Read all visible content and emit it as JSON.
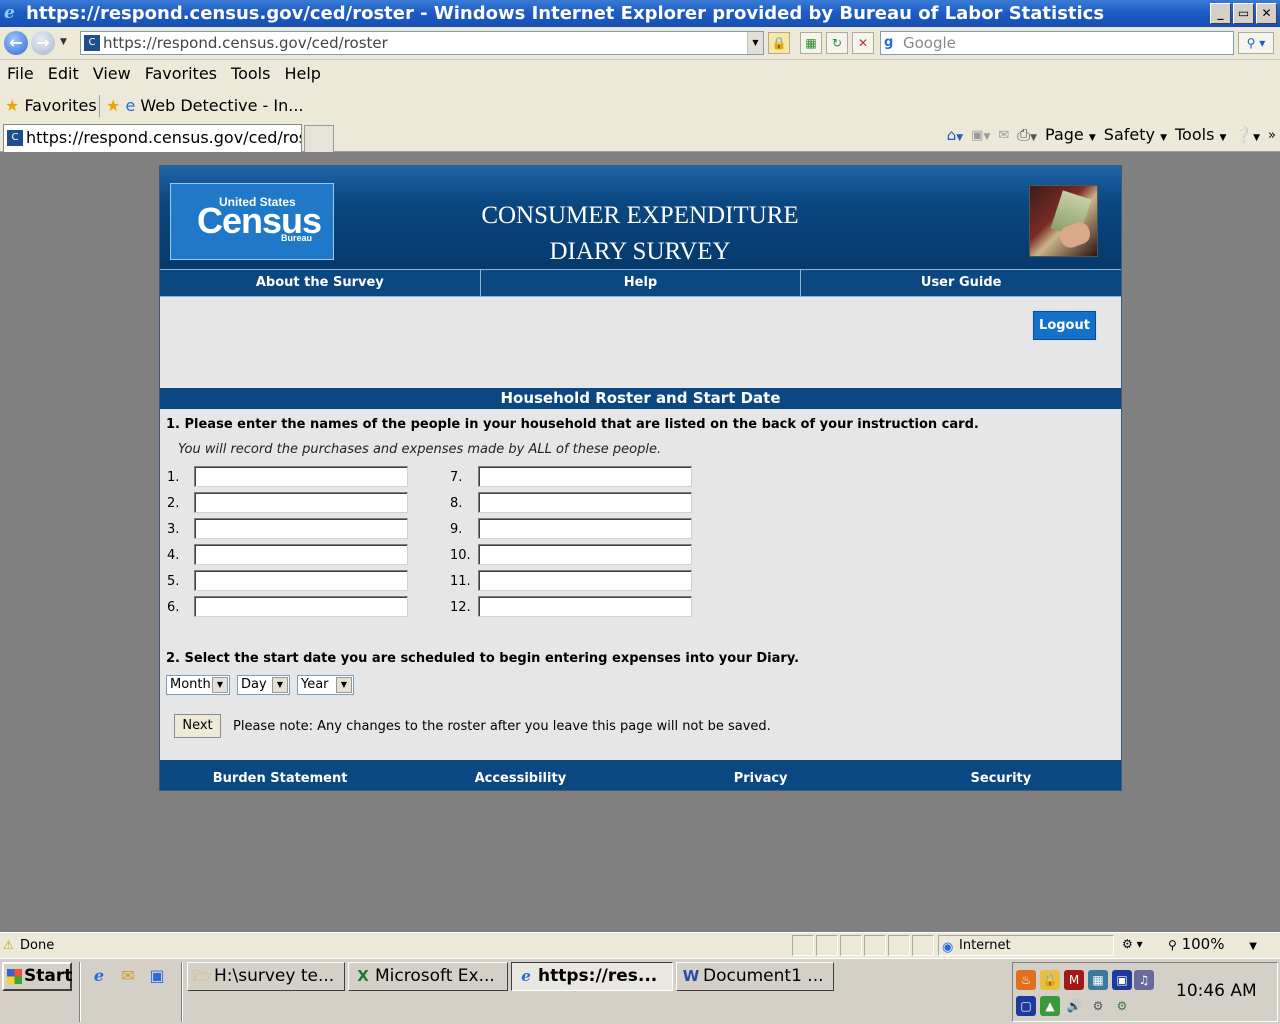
{
  "window": {
    "title": "https://respond.census.gov/ced/roster - Windows Internet Explorer provided by Bureau of Labor Statistics",
    "controls": [
      "_",
      "▭",
      "✕"
    ]
  },
  "addressbar": {
    "url": "https://respond.census.gov/ced/roster",
    "search_placeholder": "Google"
  },
  "menu": [
    "File",
    "Edit",
    "View",
    "Favorites",
    "Tools",
    "Help"
  ],
  "favorites": {
    "label": "Favorites",
    "item": "Web Detective - In..."
  },
  "tab": {
    "label": "https://respond.census.gov/ced/ros..."
  },
  "commandbar": {
    "page": "Page",
    "safety": "Safety",
    "tools": "Tools"
  },
  "site": {
    "logo_top": "United States",
    "logo_main": "Census",
    "logo_bottom": "Bureau",
    "title_line1": "CONSUMER EXPENDITURE",
    "title_line2": "DIARY SURVEY",
    "nav": [
      "About the Survey",
      "Help",
      "User Guide"
    ],
    "logout": "Logout",
    "section_title": "Household Roster and Start Date",
    "q1": "1. Please enter the names of the people in your household that are listed on the back of your instruction card.",
    "q1_note": "You will record the purchases and expenses made by ALL of these people.",
    "roster_left": [
      "1.",
      "2.",
      "3.",
      "4.",
      "5.",
      "6."
    ],
    "roster_right": [
      "7.",
      "8.",
      "9.",
      "10.",
      "11.",
      "12."
    ],
    "q2": "2. Select the start date you are scheduled to begin entering expenses into your Diary.",
    "month": "Month",
    "day": "Day",
    "year": "Year",
    "next": "Next",
    "note": "Please note: Any changes to the roster after you leave this page will not be saved.",
    "footer": [
      "Burden Statement",
      "Accessibility",
      "Privacy",
      "Security"
    ]
  },
  "status": {
    "text": "Done",
    "zone": "Internet",
    "zoom": "100%"
  },
  "taskbar": {
    "start": "Start",
    "buttons": [
      "H:\\survey te...",
      "Microsoft Ex...",
      "https://res...",
      "Document1 ..."
    ],
    "clock": "10:46 AM"
  }
}
